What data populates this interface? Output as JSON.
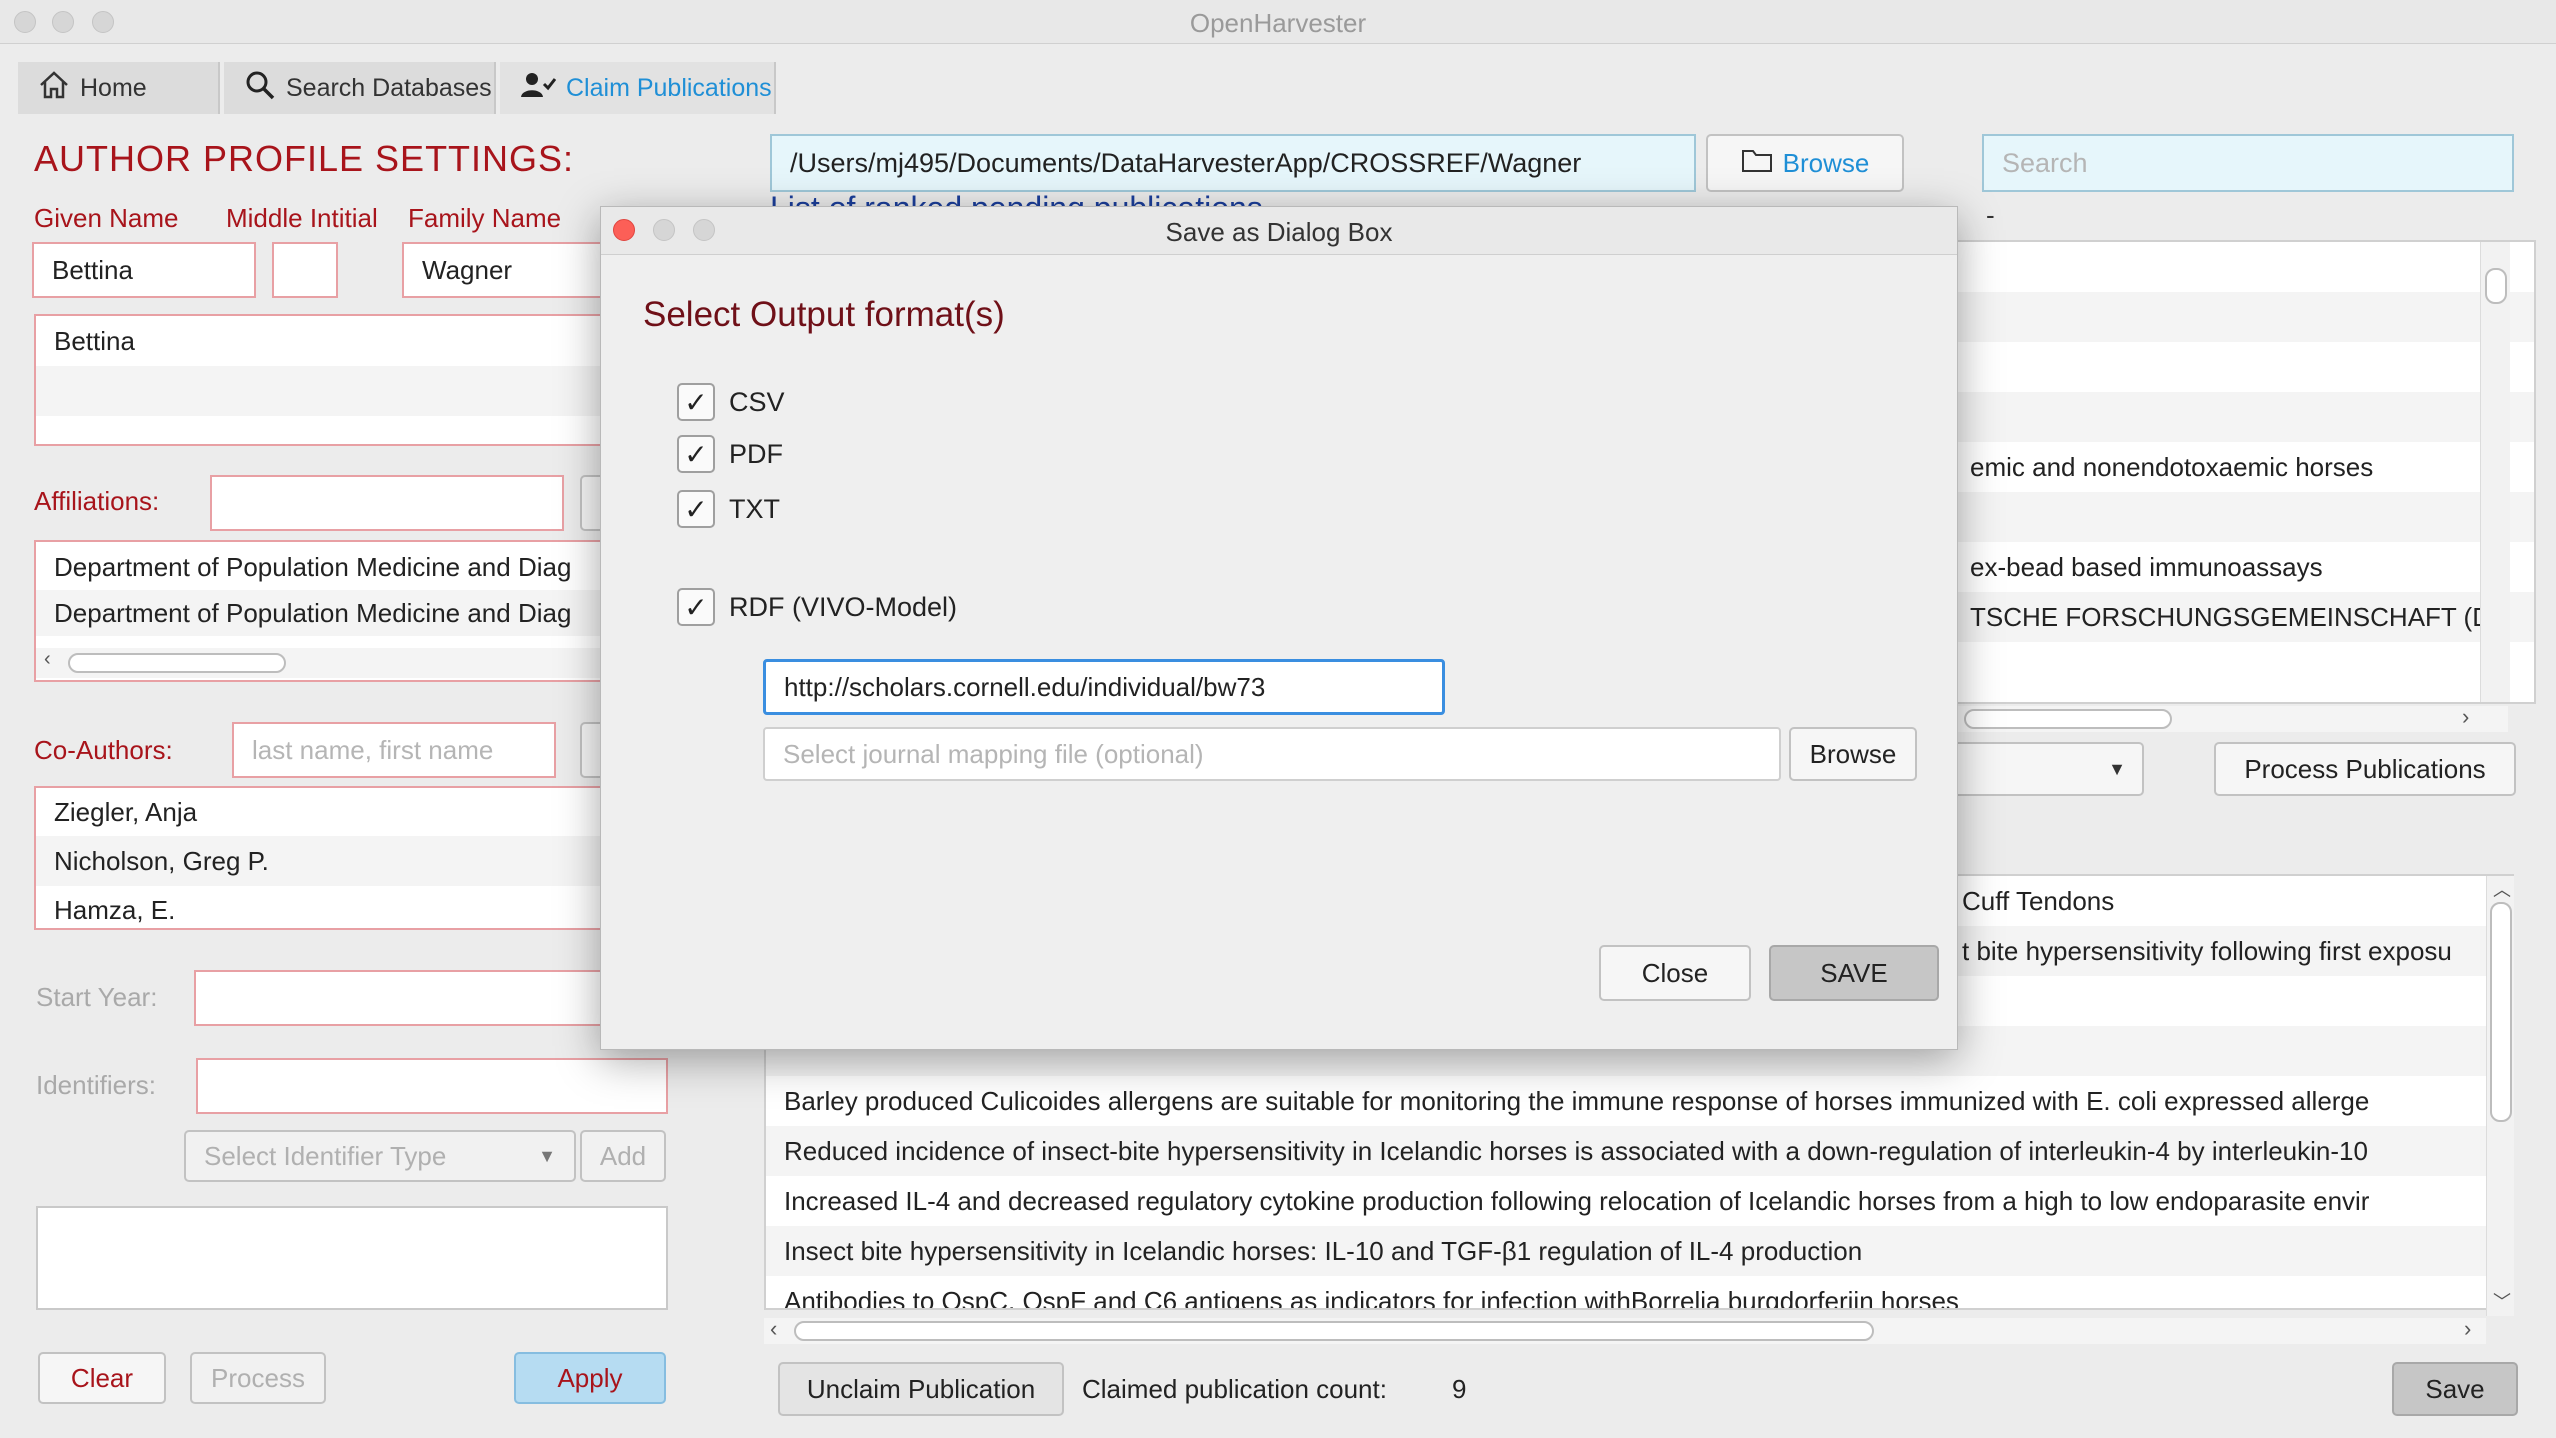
{
  "window": {
    "title": "OpenHarvester"
  },
  "tabs": [
    {
      "label": "Home",
      "icon": "home-icon"
    },
    {
      "label": "Search Databases",
      "icon": "search-icon"
    },
    {
      "label": "Claim Publications",
      "icon": "user-check-icon"
    }
  ],
  "profile": {
    "heading": "AUTHOR PROFILE SETTINGS:",
    "given_label": "Given Name",
    "middle_label": "Middle Intitial",
    "family_label": "Family Name",
    "given_value": "Bettina",
    "middle_value": "",
    "family_value": "Wagner",
    "name_variants": [
      "Bettina"
    ],
    "affiliations_label": "Affiliations:",
    "affiliations": [
      "Department of Population Medicine and Diag",
      "Department of Population Medicine and Diag"
    ],
    "coauthors_label": "Co-Authors:",
    "coauthor_placeholder": "last name, first name",
    "coauthors": [
      "Ziegler, Anja",
      "Nicholson, Greg P.",
      "Hamza, E."
    ],
    "start_year_label": "Start Year:",
    "identifiers_label": "Identifiers:",
    "identifier_type_placeholder": "Select Identifier Type",
    "add_label": "Add",
    "clear_label": "Clear",
    "process_label": "Process",
    "apply_label": "Apply"
  },
  "main": {
    "path_value": "/Users/mj495/Documents/DataHarvesterApp/CROSSREF/Wagner",
    "browse_label": "Browse",
    "search_placeholder": "Search",
    "ranked_header": "List of ranked pending publications",
    "dash": "-",
    "top_list": [
      "",
      "",
      "",
      "",
      "emic and nonendotoxaemic horses",
      "",
      "ex-bead based immunoassays",
      "TSCHE FORSCHUNGSGEMEINSCHAFT (DF"
    ],
    "process_publications_label": "Process Publications",
    "claimed_list": [
      "Cuff Tendons",
      "t bite hypersensitivity following first exposu",
      "",
      "",
      "Barley produced  Culicoides  allergens are suitable for monitoring the immune response of horses immunized with  E. coli  expressed allerge",
      "Reduced incidence of insect-bite hypersensitivity in Icelandic horses is associated with a down-regulation of interleukin-4 by interleukin-10",
      "Increased IL-4 and decreased regulatory cytokine production following relocation of Icelandic horses from a high to low endoparasite envir",
      "Insect bite hypersensitivity in Icelandic horses: IL-10 and TGF-β1 regulation of IL-4 production",
      "Antibodies to OspC, OspF and C6 antigens as indicators for infection withBorrelia burgdorferiin horses"
    ],
    "unclaim_label": "Unclaim Publication",
    "claimed_count_label": "Claimed publication count:",
    "claimed_count": "9",
    "save_label": "Save"
  },
  "dialog": {
    "title": "Save as Dialog Box",
    "heading": "Select Output format(s)",
    "formats": [
      {
        "label": "CSV",
        "checked": true
      },
      {
        "label": "PDF",
        "checked": true
      },
      {
        "label": "TXT",
        "checked": true
      },
      {
        "label": "RDF (VIVO-Model)",
        "checked": true
      }
    ],
    "uri_value": "http://scholars.cornell.edu/individual/bw73",
    "mapping_placeholder": "Select journal mapping file (optional)",
    "browse_label": "Browse",
    "close_label": "Close",
    "save_label": "SAVE"
  },
  "colors": {
    "accent_red": "#a8141b",
    "accent_blue": "#1f8fd6",
    "mac_close": "#fc5f57"
  }
}
